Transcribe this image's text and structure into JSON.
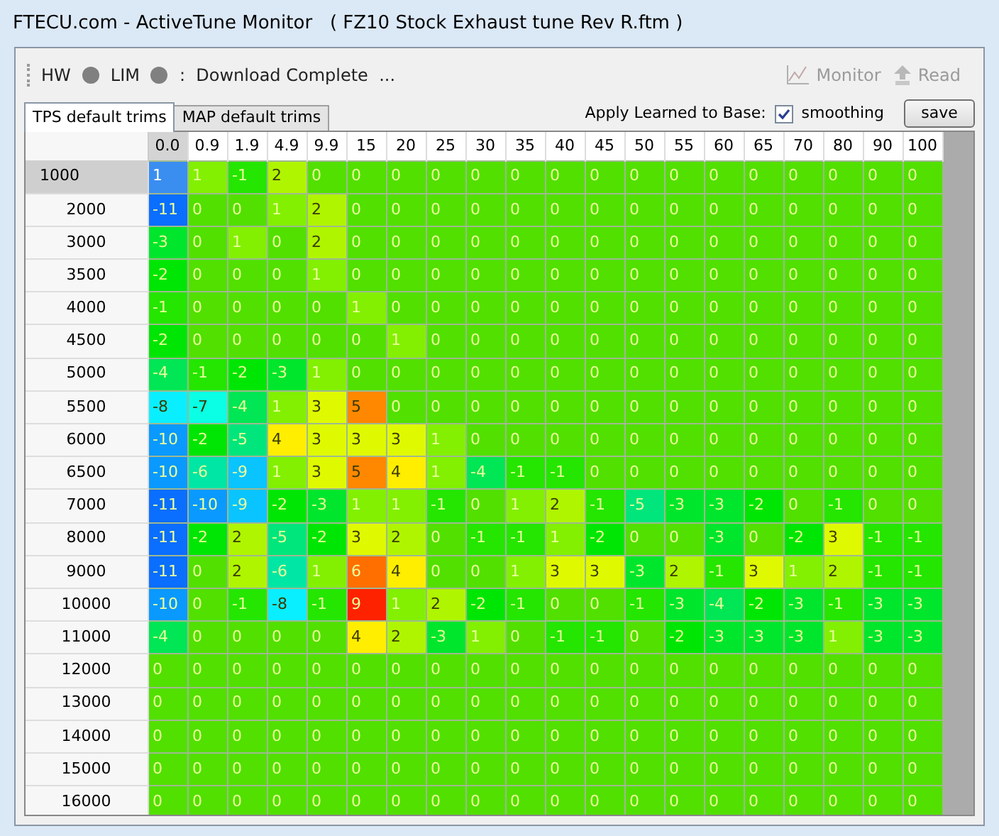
{
  "window": {
    "title": "FTECU.com - ActiveTune Monitor   ( FZ10 Stock Exhaust tune Rev R.ftm )"
  },
  "toolbar": {
    "indicators": [
      {
        "label": "HW",
        "on": false
      },
      {
        "label": "LIM",
        "on": false
      }
    ],
    "status": ":  Download Complete  ...",
    "buttons": [
      {
        "label": "Monitor",
        "kind": "chart",
        "disabled": true
      },
      {
        "label": "Read",
        "kind": "read",
        "disabled": true
      }
    ]
  },
  "tabs": [
    {
      "label": "TPS default trims",
      "selected": true
    },
    {
      "label": "MAP default trims",
      "selected": false
    }
  ],
  "apply": {
    "label": "Apply Learned to Base:",
    "smoothing": {
      "label": "smoothing",
      "checked": true
    },
    "save": "save"
  },
  "table": {
    "columns": [
      "0.0",
      "0.9",
      "1.9",
      "4.9",
      "9.9",
      "15",
      "20",
      "25",
      "30",
      "35",
      "40",
      "45",
      "50",
      "55",
      "60",
      "65",
      "70",
      "80",
      "90",
      "100"
    ],
    "rows": [
      {
        "label": "1000",
        "selected": true,
        "cells": [
          "1",
          "1",
          "-1",
          "2",
          "0",
          "0",
          "0",
          "0",
          "0",
          "0",
          "0",
          "0",
          "0",
          "0",
          "0",
          "0",
          "0",
          "0",
          "0",
          "0"
        ]
      },
      {
        "label": "2000",
        "selected": false,
        "cells": [
          "-11",
          "0",
          "0",
          "1",
          "2",
          "0",
          "0",
          "0",
          "0",
          "0",
          "0",
          "0",
          "0",
          "0",
          "0",
          "0",
          "0",
          "0",
          "0",
          "0"
        ]
      },
      {
        "label": "3000",
        "selected": false,
        "cells": [
          "-3",
          "0",
          "1",
          "0",
          "2",
          "0",
          "0",
          "0",
          "0",
          "0",
          "0",
          "0",
          "0",
          "0",
          "0",
          "0",
          "0",
          "0",
          "0",
          "0"
        ]
      },
      {
        "label": "3500",
        "selected": false,
        "cells": [
          "-2",
          "0",
          "0",
          "0",
          "1",
          "0",
          "0",
          "0",
          "0",
          "0",
          "0",
          "0",
          "0",
          "0",
          "0",
          "0",
          "0",
          "0",
          "0",
          "0"
        ]
      },
      {
        "label": "4000",
        "selected": false,
        "cells": [
          "-1",
          "0",
          "0",
          "0",
          "0",
          "1",
          "0",
          "0",
          "0",
          "0",
          "0",
          "0",
          "0",
          "0",
          "0",
          "0",
          "0",
          "0",
          "0",
          "0"
        ]
      },
      {
        "label": "4500",
        "selected": false,
        "cells": [
          "-2",
          "0",
          "0",
          "0",
          "0",
          "0",
          "1",
          "0",
          "0",
          "0",
          "0",
          "0",
          "0",
          "0",
          "0",
          "0",
          "0",
          "0",
          "0",
          "0"
        ]
      },
      {
        "label": "5000",
        "selected": false,
        "cells": [
          "-4",
          "-1",
          "-2",
          "-3",
          "1",
          "0",
          "0",
          "0",
          "0",
          "0",
          "0",
          "0",
          "0",
          "0",
          "0",
          "0",
          "0",
          "0",
          "0",
          "0"
        ]
      },
      {
        "label": "5500",
        "selected": false,
        "cells": [
          "-8",
          "-7",
          "-4",
          "1",
          "3",
          "5",
          "0",
          "0",
          "0",
          "0",
          "0",
          "0",
          "0",
          "0",
          "0",
          "0",
          "0",
          "0",
          "0",
          "0"
        ]
      },
      {
        "label": "6000",
        "selected": false,
        "cells": [
          "-10",
          "-2",
          "-5",
          "4",
          "3",
          "3",
          "3",
          "1",
          "0",
          "0",
          "0",
          "0",
          "0",
          "0",
          "0",
          "0",
          "0",
          "0",
          "0",
          "0"
        ]
      },
      {
        "label": "6500",
        "selected": false,
        "cells": [
          "-10",
          "-6",
          "-9",
          "1",
          "3",
          "5",
          "4",
          "1",
          "-4",
          "-1",
          "-1",
          "0",
          "0",
          "0",
          "0",
          "0",
          "0",
          "0",
          "0",
          "0"
        ]
      },
      {
        "label": "7000",
        "selected": false,
        "cells": [
          "-11",
          "-10",
          "-9",
          "-2",
          "-3",
          "1",
          "1",
          "-1",
          "0",
          "1",
          "2",
          "-1",
          "-5",
          "-3",
          "-3",
          "-2",
          "0",
          "-1",
          "0",
          "0"
        ]
      },
      {
        "label": "8000",
        "selected": false,
        "cells": [
          "-11",
          "-2",
          "2",
          "-5",
          "-2",
          "3",
          "2",
          "0",
          "-1",
          "-1",
          "1",
          "-2",
          "0",
          "0",
          "-3",
          "0",
          "-2",
          "3",
          "-1",
          "-1"
        ]
      },
      {
        "label": "9000",
        "selected": false,
        "cells": [
          "-11",
          "0",
          "2",
          "-6",
          "1",
          "6",
          "4",
          "0",
          "0",
          "1",
          "3",
          "3",
          "-3",
          "2",
          "-1",
          "3",
          "1",
          "2",
          "-1",
          "-1"
        ]
      },
      {
        "label": "10000",
        "selected": false,
        "cells": [
          "-10",
          "0",
          "-1",
          "-8",
          "-1",
          "9",
          "1",
          "2",
          "-2",
          "-1",
          "0",
          "0",
          "-1",
          "-3",
          "-4",
          "-2",
          "-3",
          "-1",
          "-3",
          "-3"
        ]
      },
      {
        "label": "11000",
        "selected": false,
        "cells": [
          "-4",
          "0",
          "0",
          "0",
          "0",
          "4",
          "2",
          "-3",
          "1",
          "0",
          "-1",
          "-1",
          "0",
          "-2",
          "-3",
          "-3",
          "-3",
          "1",
          "-3",
          "-3"
        ]
      },
      {
        "label": "12000",
        "selected": false,
        "cells": [
          "0",
          "0",
          "0",
          "0",
          "0",
          "0",
          "0",
          "0",
          "0",
          "0",
          "0",
          "0",
          "0",
          "0",
          "0",
          "0",
          "0",
          "0",
          "0",
          "0"
        ]
      },
      {
        "label": "13000",
        "selected": false,
        "cells": [
          "0",
          "0",
          "0",
          "0",
          "0",
          "0",
          "0",
          "0",
          "0",
          "0",
          "0",
          "0",
          "0",
          "0",
          "0",
          "0",
          "0",
          "0",
          "0",
          "0"
        ]
      },
      {
        "label": "14000",
        "selected": false,
        "cells": [
          "0",
          "0",
          "0",
          "0",
          "0",
          "0",
          "0",
          "0",
          "0",
          "0",
          "0",
          "0",
          "0",
          "0",
          "0",
          "0",
          "0",
          "0",
          "0",
          "0"
        ]
      },
      {
        "label": "15000",
        "selected": false,
        "cells": [
          "0",
          "0",
          "0",
          "0",
          "0",
          "0",
          "0",
          "0",
          "0",
          "0",
          "0",
          "0",
          "0",
          "0",
          "0",
          "0",
          "0",
          "0",
          "0",
          "0"
        ]
      },
      {
        "label": "16000",
        "selected": false,
        "cells": [
          "0",
          "0",
          "0",
          "0",
          "0",
          "0",
          "0",
          "0",
          "0",
          "0",
          "0",
          "0",
          "0",
          "0",
          "0",
          "0",
          "0",
          "0",
          "0",
          "0"
        ]
      }
    ]
  }
}
